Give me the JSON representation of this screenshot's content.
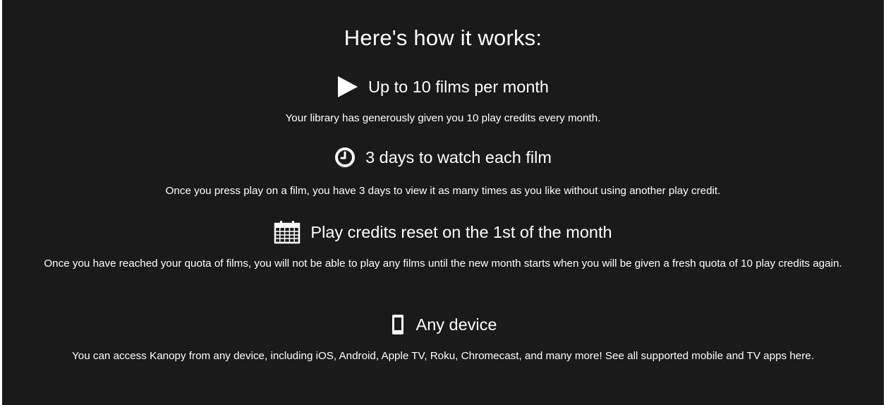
{
  "heading": "Here's how it works:",
  "features": [
    {
      "icon": "play-icon",
      "title": "Up to 10 films per month",
      "description": "Your library has generously given you 10 play credits every month."
    },
    {
      "icon": "clock-icon",
      "title": "3 days to watch each film",
      "description": "Once you press play on a film, you have 3 days to view it as many times as you like without using another play credit."
    },
    {
      "icon": "calendar-icon",
      "title": "Play credits reset on the 1st of the month",
      "description": "Once you have reached your quota of films, you will not be able to play any films until the new month starts when you will be given a fresh quota of 10 play credits again."
    },
    {
      "icon": "mobile-device-icon",
      "title": "Any device",
      "description": "You can access Kanopy from any device, including iOS, Android, Apple TV, Roku, Chromecast, and many more! See all supported mobile and TV apps here."
    }
  ],
  "colors": {
    "background": "#1a1a1a",
    "text": "#ffffff"
  }
}
